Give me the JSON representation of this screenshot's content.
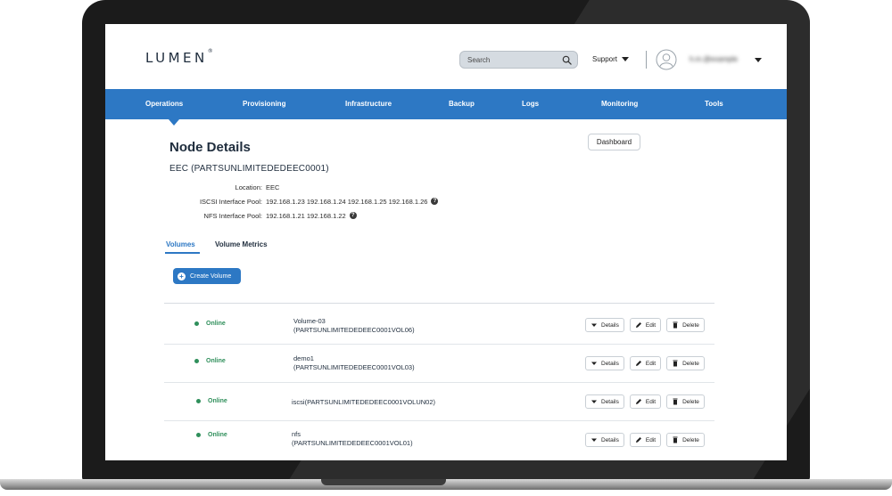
{
  "brand": {
    "logo": "LUMEN",
    "trademark": "®"
  },
  "header": {
    "search_placeholder": "Search",
    "support_label": "Support",
    "username": "h.m.@example"
  },
  "nav": {
    "items": [
      {
        "label": "Operations",
        "active": true
      },
      {
        "label": "Provisioning"
      },
      {
        "label": "Infrastructure"
      },
      {
        "label": "Backup"
      },
      {
        "label": "Logs"
      },
      {
        "label": "Monitoring"
      },
      {
        "label": "Tools"
      }
    ]
  },
  "page": {
    "title": "Node Details",
    "dashboard_label": "Dashboard",
    "node_id": "EEC (PARTSUNLIMITEDEDEEC0001)"
  },
  "details": [
    {
      "label": "Location:",
      "value": "EEC",
      "help": false
    },
    {
      "label": "ISCSI Interface Pool:",
      "value": "192.168.1.23 192.168.1.24 192.168.1.25 192.168.1.26",
      "help": true
    },
    {
      "label": "NFS Interface Pool:",
      "value": "192.168.1.21 192.168.1.22",
      "help": true
    }
  ],
  "tabs": [
    {
      "label": "Volumes",
      "active": true
    },
    {
      "label": "Volume Metrics",
      "active": false
    }
  ],
  "create_button_label": "Create Volume",
  "actions": {
    "details": "Details",
    "edit": "Edit",
    "delete": "Delete"
  },
  "volumes": [
    {
      "status": "Online",
      "name_line1": "Volume-03",
      "name_line2": "(PARTSUNLIMITEDEDEEC0001VOL06)"
    },
    {
      "status": "Online",
      "name_line1": "demo1",
      "name_line2": "(PARTSUNLIMITEDEDEEC0001VOL03)"
    },
    {
      "status": "Online",
      "name_line1": "iscsi(PARTSUNLIMITEDEDEEC0001VOLUN02)",
      "name_line2": ""
    },
    {
      "status": "Online",
      "name_line1": "nfs",
      "name_line2": "(PARTSUNLIMITEDEDEEC0001VOL01)"
    }
  ],
  "colors": {
    "accent": "#2d78c4",
    "online": "#2f8f5b",
    "text": "#1f2d3d"
  }
}
